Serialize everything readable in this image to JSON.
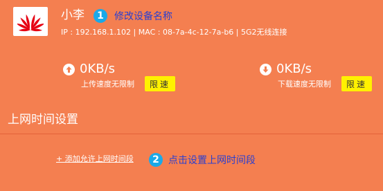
{
  "device": {
    "name": "小李",
    "info": "IP : 192.168.1.102 | MAC : 08-7a-4c-12-7a-b6 | 5G2无线连接"
  },
  "annotations": {
    "step1_number": "1",
    "step1_text": "修改设备名称",
    "step2_number": "2",
    "step2_text": "点击设置上网时间段"
  },
  "upload": {
    "icon": "arrow-up-circle-icon",
    "value": "0KB/s",
    "note": "上传速度无限制",
    "button": "限速"
  },
  "download": {
    "icon": "arrow-down-circle-icon",
    "value": "0KB/s",
    "note": "下载速度无限制",
    "button": "限速"
  },
  "schedule": {
    "title": "上网时间设置",
    "add_link": "+ 添加允许上网时间段"
  },
  "colors": {
    "background": "#f47f50",
    "badge": "#1aa9e8",
    "annotation_text": "#2a3fd0",
    "button_bg": "#fff100",
    "logo_red": "#e60012"
  }
}
